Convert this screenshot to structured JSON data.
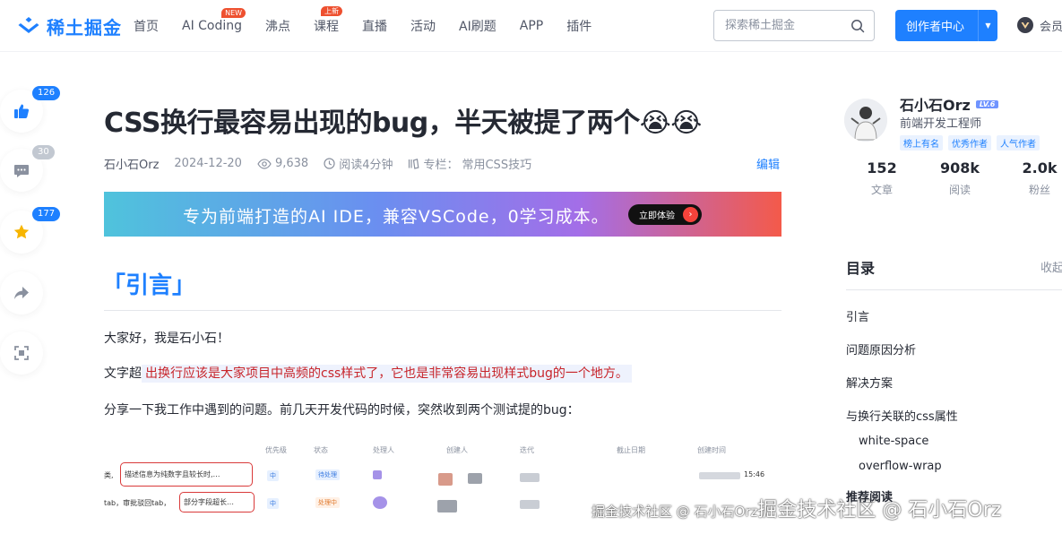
{
  "header": {
    "logo_text": "稀土掘金",
    "nav": [
      {
        "label": "首页",
        "badge": ""
      },
      {
        "label": "AI Coding",
        "badge": "NEW"
      },
      {
        "label": "沸点",
        "badge": ""
      },
      {
        "label": "课程",
        "badge": "上新"
      },
      {
        "label": "直播",
        "badge": ""
      },
      {
        "label": "活动",
        "badge": ""
      },
      {
        "label": "AI刷题",
        "badge": ""
      },
      {
        "label": "APP",
        "badge": ""
      },
      {
        "label": "插件",
        "badge": ""
      }
    ],
    "search_placeholder": "探索稀土掘金",
    "creator_label": "创作者中心",
    "vip_label": "会员"
  },
  "actions": {
    "likes": "126",
    "comments": "30",
    "favorites": "177"
  },
  "article": {
    "title": "CSS换行最容易出现的bug，半天被提了两个😭😭",
    "author": "石小石Orz",
    "date": "2024-12-20",
    "views": "9,638",
    "read_time": "阅读4分钟",
    "column_label": "专栏：",
    "column_name": "常用CSS技巧",
    "edit_label": "编辑",
    "banner_text": "专为前端打造的AI IDE，兼容VSCode，0学习成本。",
    "banner_button": "立即体验",
    "h2": "「引言」",
    "p1": "大家好，我是石小石！",
    "p2_prefix": "文字超",
    "p2_highlight": "出换行应该是大家项目中高频的css样式了，它也是非常容易出现样式bug的一个地方。",
    "p3": "分享一下我工作中遇到的问题。前几天开发代码的时候，突然收到两个测试提的bug："
  },
  "embedded_table": {
    "headers": [
      "优先级",
      "状态",
      "处理人",
      "创建人",
      "迭代",
      "截止日期",
      "创建时间"
    ],
    "row1_prefix": "类,",
    "row1_box": "描述信息为纯数字且较长时,…",
    "row1_priority": "中",
    "row1_status": "待处理",
    "row1_time": "15:46",
    "row2_prefix": "tab，审批驳回tab，",
    "row2_box": "部分字段超长…",
    "row2_priority": "中",
    "row2_status": "处理中"
  },
  "watermark": {
    "small": "掘金技术社区 @ 石小石Orz",
    "big": "掘金技术社区 @ 石小石Orz"
  },
  "author_card": {
    "name": "石小石Orz",
    "level": "LV.6",
    "title": "前端开发工程师",
    "honors": [
      "榜上有名",
      "优秀作者",
      "人气作者"
    ],
    "stats": [
      {
        "value": "152",
        "label": "文章"
      },
      {
        "value": "908k",
        "label": "阅读"
      },
      {
        "value": "2.0k",
        "label": "粉丝"
      }
    ]
  },
  "toc": {
    "title": "目录",
    "fold_label": "收起",
    "items": [
      "引言",
      "问题原因分析",
      "解决方案",
      "与换行关联的css属性",
      "white-space",
      "overflow-wrap",
      "推荐阅读"
    ]
  },
  "colors": {
    "brand": "#1e80ff",
    "highlight_text": "#c7242a"
  }
}
